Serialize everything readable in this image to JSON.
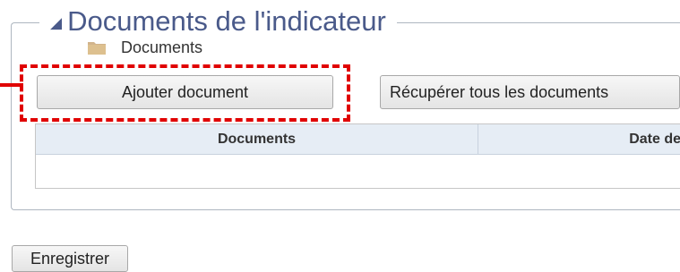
{
  "section": {
    "title": "Documents de l'indicateur",
    "collapse_icon": "triangle-collapse-icon"
  },
  "toolbar": {
    "add_label": "Ajouter document",
    "get_all_label": "Récupérer tous les documents"
  },
  "table": {
    "columns": [
      "Documents",
      "Date de"
    ],
    "rows": [
      {
        "icon": "folder-icon",
        "label": "Documents"
      }
    ]
  },
  "footer": {
    "save_label": "Enregistrer"
  },
  "colors": {
    "legend": "#4a5a8a",
    "highlight": "#e00000",
    "header_bg": "#e6edf5",
    "folder": "#d2b48c"
  }
}
